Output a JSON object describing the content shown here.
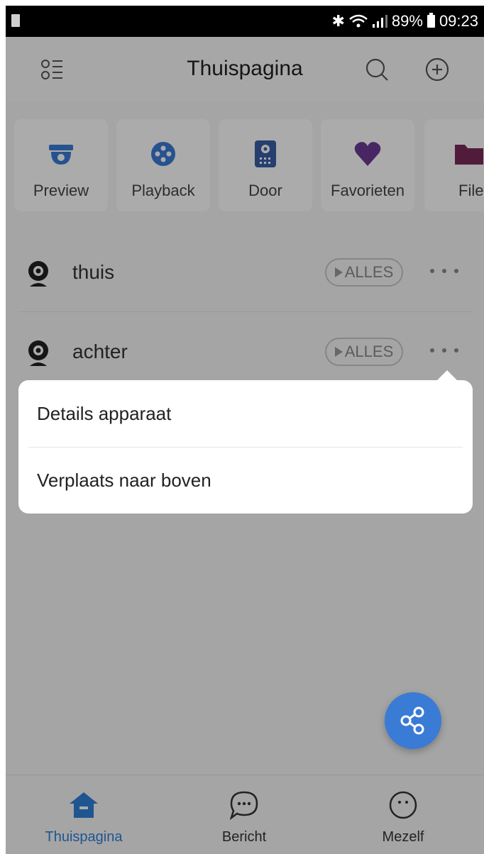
{
  "status_bar": {
    "battery": "89%",
    "time": "09:23"
  },
  "header": {
    "title": "Thuispagina",
    "left_icon": "list-menu-icon",
    "search_icon": "search-icon",
    "add_icon": "add-circle-icon"
  },
  "quick_actions": [
    {
      "label": "Preview",
      "icon": "dome-camera-icon",
      "color": "#3a7bd5"
    },
    {
      "label": "Playback",
      "icon": "reel-icon",
      "color": "#3a7bd5"
    },
    {
      "label": "Door",
      "icon": "intercom-icon",
      "color": "#3a5fa8"
    },
    {
      "label": "Favorieten",
      "icon": "heart-icon",
      "color": "#6a3a94"
    },
    {
      "label": "File",
      "icon": "folder-icon",
      "color": "#7a2a5a"
    }
  ],
  "devices": [
    {
      "name": "thuis",
      "play_all": "ALLES"
    },
    {
      "name": "achter",
      "play_all": "ALLES"
    }
  ],
  "popup_menu": {
    "items": [
      "Details apparaat",
      "Verplaats naar boven"
    ]
  },
  "bottom_nav": {
    "tabs": [
      {
        "label": "Thuispagina",
        "icon": "home-icon",
        "active": true
      },
      {
        "label": "Bericht",
        "icon": "message-bubble-icon",
        "active": false
      },
      {
        "label": "Mezelf",
        "icon": "smiley-icon",
        "active": false
      }
    ],
    "accent": "#2f7fd8"
  },
  "fab": {
    "icon": "share-icon",
    "color": "#3a7bd5"
  }
}
